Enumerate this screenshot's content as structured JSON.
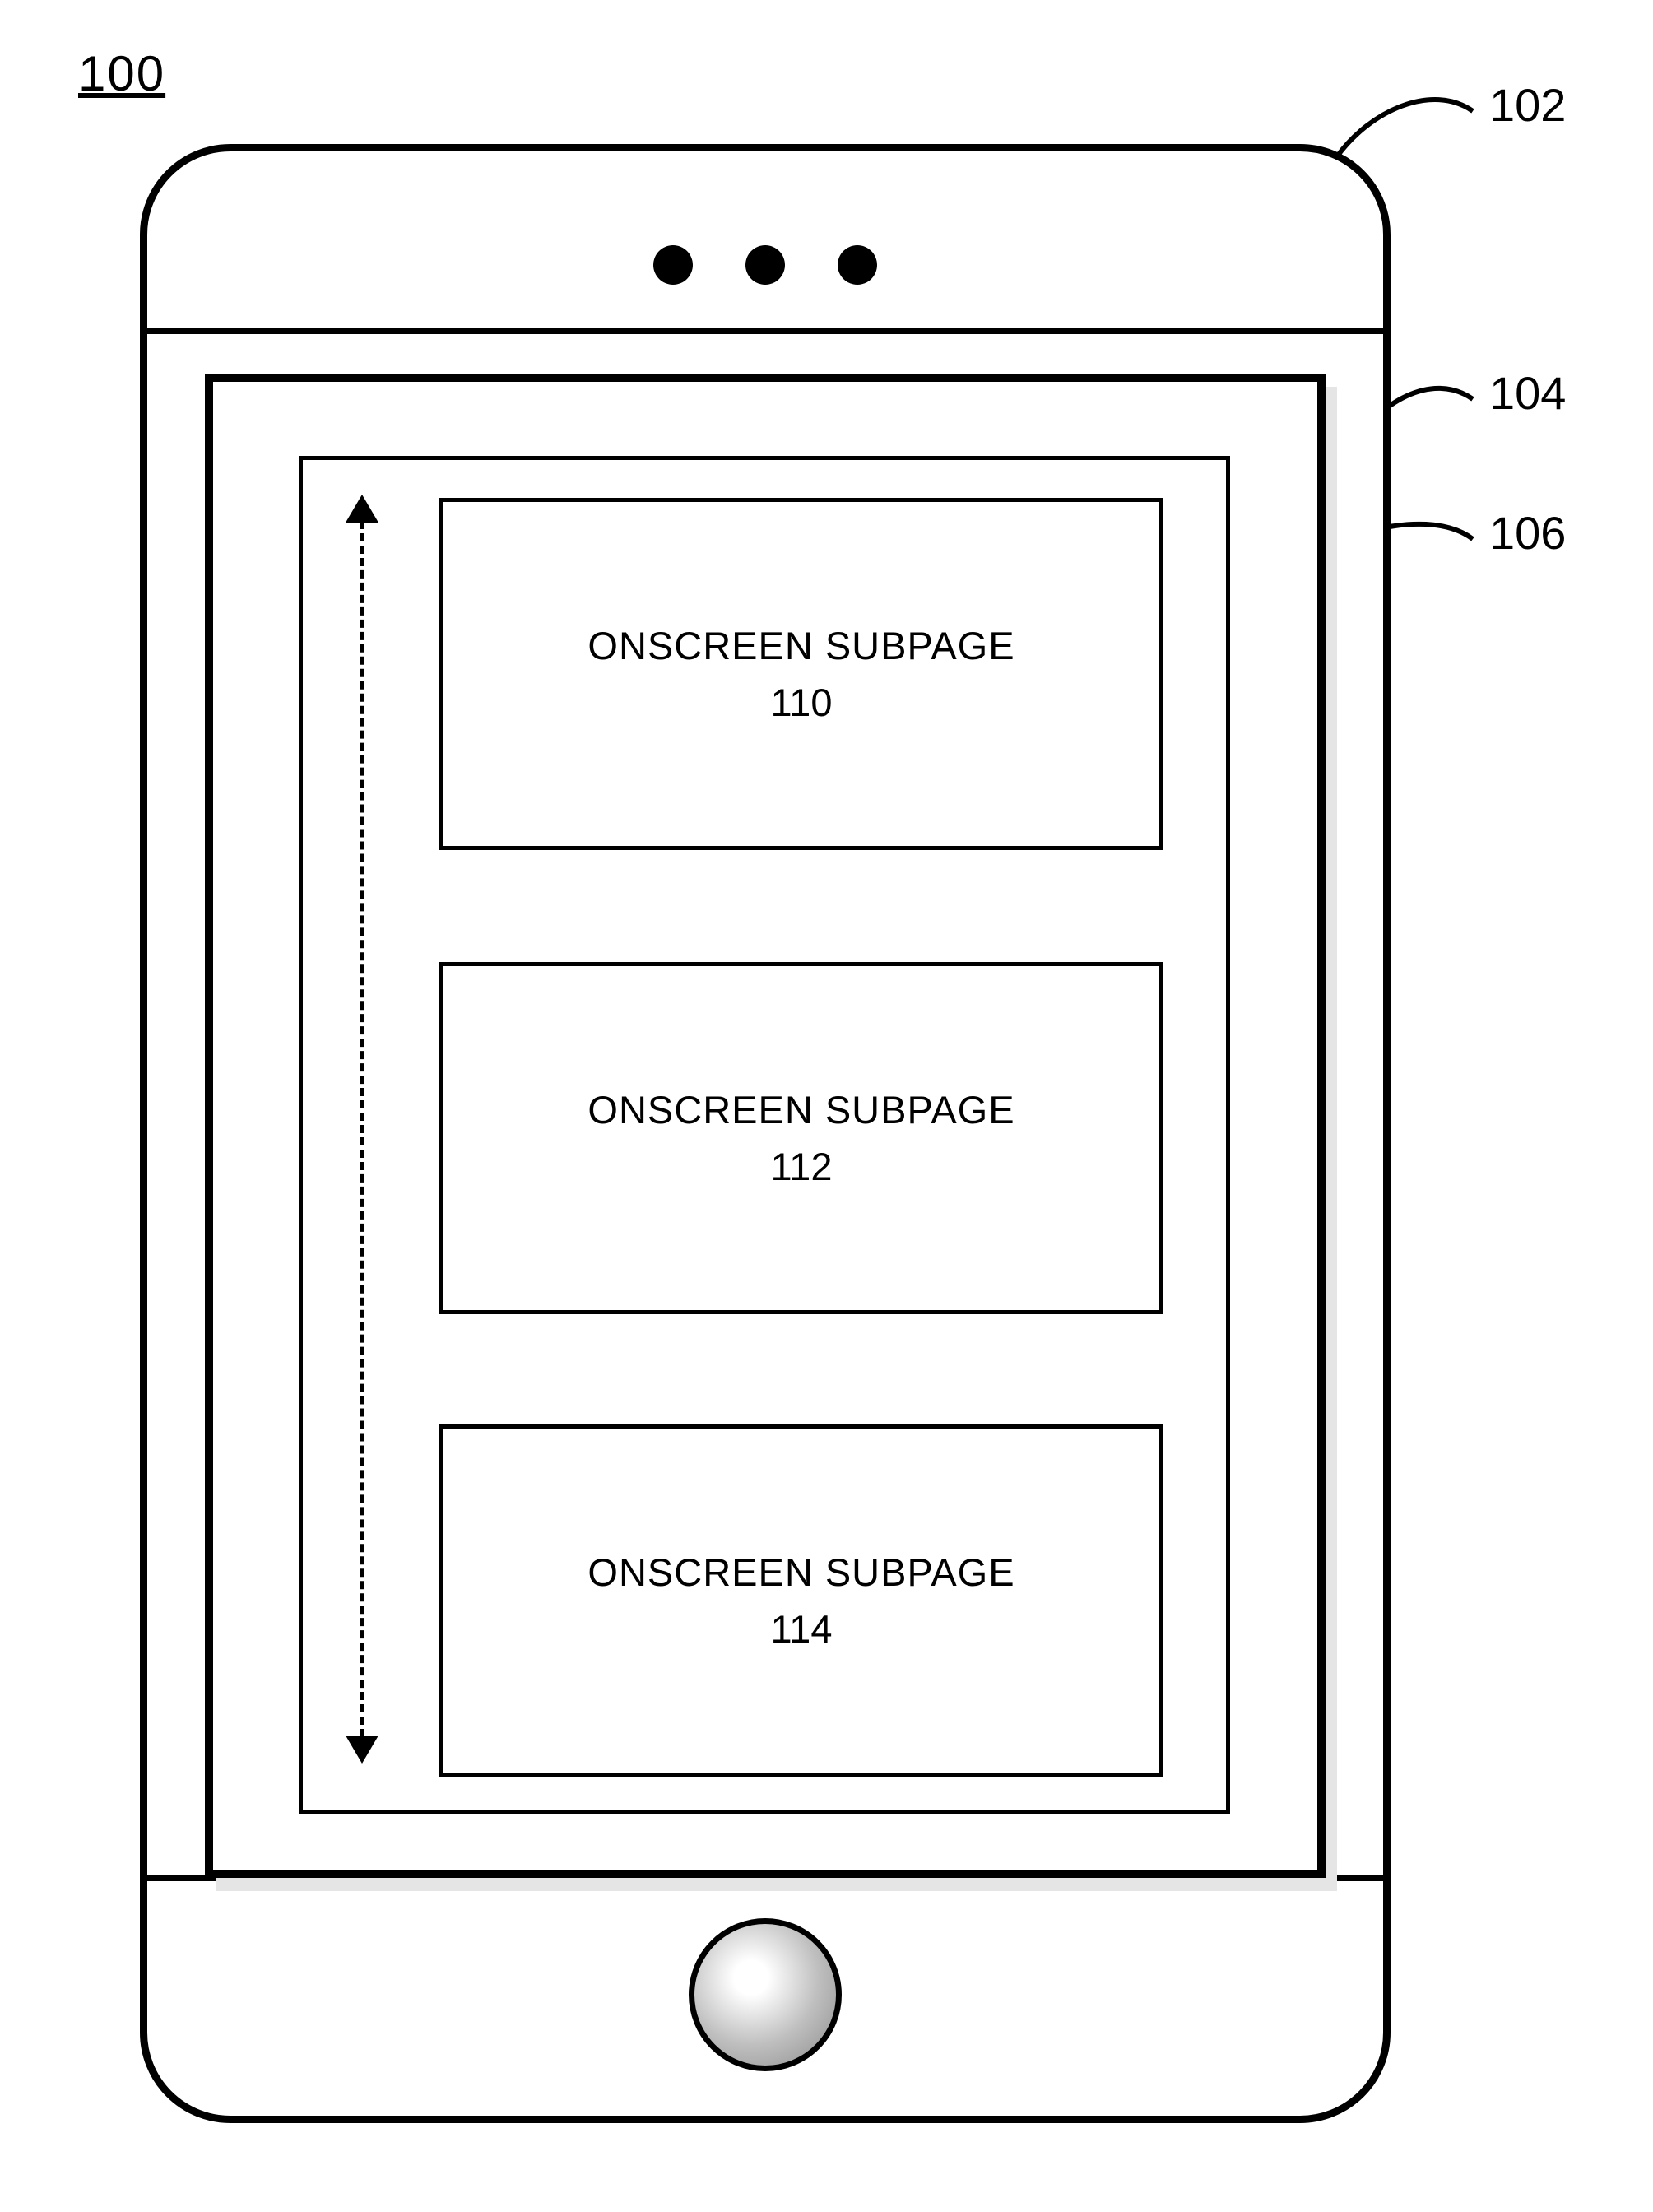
{
  "figure_number": "100",
  "refs": {
    "device": "102",
    "display": "104",
    "inner": "106"
  },
  "subpages": [
    {
      "title": "ONSCREEN SUBPAGE",
      "num": "110"
    },
    {
      "title": "ONSCREEN SUBPAGE",
      "num": "112"
    },
    {
      "title": "ONSCREEN SUBPAGE",
      "num": "114"
    }
  ]
}
